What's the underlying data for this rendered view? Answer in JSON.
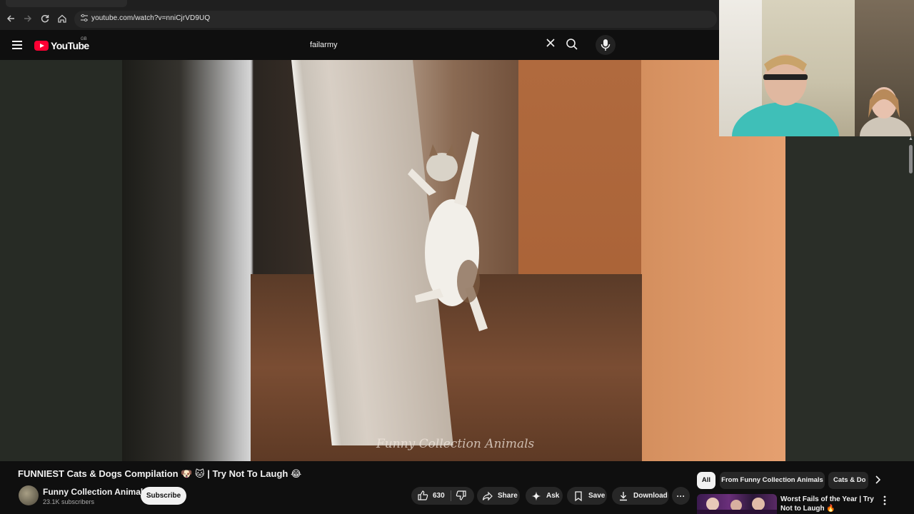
{
  "browser": {
    "url": "youtube.com/watch?v=nniCjrVD9UQ",
    "back_icon": "arrow-left",
    "forward_icon": "arrow-right",
    "reload_icon": "reload",
    "home_icon": "home"
  },
  "masthead": {
    "logo_text": "YouTube",
    "country_code": "GB",
    "search_query": "failarmy",
    "clear_icon": "close",
    "search_icon": "search",
    "mic_icon": "microphone"
  },
  "player": {
    "watermark": "Funny Collection Animals"
  },
  "video": {
    "title": "FUNNIEST Cats & Dogs Compilation 🐶 🐱 | Try Not To Laugh 😂",
    "channel_name": "Funny Collection Animals",
    "subscribers": "23.1K subscribers",
    "subscribe_label": "Subscribe",
    "like_count": "630",
    "share_label": "Share",
    "ask_label": "Ask",
    "save_label": "Save",
    "download_label": "Download",
    "more_label": "···"
  },
  "sidebar": {
    "chips": [
      "All",
      "From Funny Collection Animals",
      "Cats & Do"
    ],
    "recommendation": {
      "title": "Worst Fails of the Year | Try Not to Laugh 🔥"
    }
  },
  "colors": {
    "background": "#0f0f0f",
    "brand_red": "#ff0033",
    "pill_bg": "#272727",
    "text_primary": "#f1f1f1",
    "text_secondary": "#aaaaaa"
  }
}
